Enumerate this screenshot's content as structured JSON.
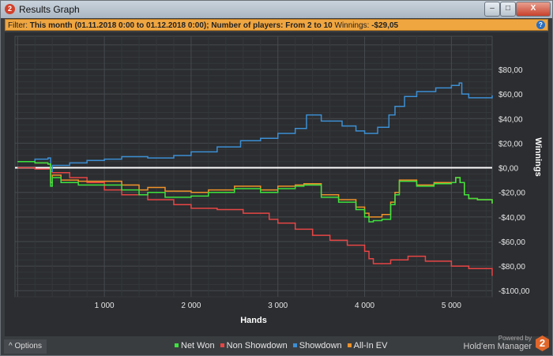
{
  "window": {
    "title": "Results Graph",
    "app_icon": "2",
    "minimize": "–",
    "maximize": "□",
    "close": "X"
  },
  "filter": {
    "label": "Filter:",
    "text": "This month (01.11.2018 0:00 to 01.12.2018 0:00); Number of players: From 2 to 10",
    "winnings_label": "Winnings:",
    "winnings_value": "-$29,05",
    "help": "?"
  },
  "footer": {
    "options": "Options",
    "options_icon": "^",
    "powered_by": "Powered by",
    "brand": "Hold'em Manager",
    "logo": "2"
  },
  "chart_data": {
    "type": "line",
    "xlabel": "Hands",
    "ylabel": "Winnings",
    "xlim": [
      -30,
      5470
    ],
    "ylim": [
      -105,
      107
    ],
    "xticks": [
      1000,
      2000,
      3000,
      4000,
      5000
    ],
    "xtick_labels": [
      "1 000",
      "2 000",
      "3 000",
      "4 000",
      "5 000"
    ],
    "yticks": [
      80,
      60,
      40,
      20,
      0,
      -20,
      -40,
      -60,
      -80,
      -100
    ],
    "ytick_labels": [
      "$80,00",
      "$60,00",
      "$40,00",
      "$20,00",
      "$0,00",
      "-$20,00",
      "-$40,00",
      "-$60,00",
      "-$80,00",
      "-$100,00"
    ],
    "grid": true,
    "legend_position": "bottom",
    "series": [
      {
        "name": "Net Won",
        "color": "#3ee23e",
        "x": [
          0,
          200,
          350,
          380,
          400,
          500,
          700,
          1000,
          1200,
          1400,
          1500,
          1700,
          2000,
          2200,
          2500,
          2800,
          3000,
          3200,
          3300,
          3500,
          3700,
          3900,
          4000,
          4050,
          4100,
          4200,
          4300,
          4350,
          4400,
          4600,
          4800,
          5000,
          5050,
          5100,
          5150,
          5200,
          5300,
          5470
        ],
        "y": [
          5,
          4,
          3,
          -15,
          -8,
          -12,
          -14,
          -14,
          -18,
          -22,
          -20,
          -24,
          -23,
          -20,
          -17,
          -20,
          -17,
          -15,
          -14,
          -24,
          -28,
          -34,
          -40,
          -44,
          -43,
          -42,
          -30,
          -22,
          -11,
          -15,
          -13,
          -12,
          -8,
          -12,
          -22,
          -25,
          -26,
          -29
        ]
      },
      {
        "name": "Non Showdown",
        "color": "#e84545",
        "x": [
          0,
          200,
          400,
          600,
          800,
          1000,
          1200,
          1500,
          1800,
          2000,
          2300,
          2600,
          2900,
          3000,
          3200,
          3400,
          3600,
          3800,
          4000,
          4050,
          4100,
          4300,
          4500,
          4700,
          5000,
          5200,
          5470
        ],
        "y": [
          0,
          -1,
          -4,
          -8,
          -12,
          -18,
          -22,
          -26,
          -30,
          -33,
          -34,
          -37,
          -42,
          -45,
          -50,
          -55,
          -59,
          -63,
          -68,
          -74,
          -78,
          -75,
          -72,
          -76,
          -80,
          -82,
          -88
        ]
      },
      {
        "name": "Showdown",
        "color": "#3c8fd4",
        "x": [
          0,
          200,
          350,
          380,
          400,
          600,
          800,
          1000,
          1200,
          1500,
          1800,
          2000,
          2300,
          2570,
          2800,
          3000,
          3200,
          3330,
          3500,
          3740,
          3900,
          4000,
          4150,
          4280,
          4350,
          4460,
          4600,
          4820,
          5000,
          5090,
          5120,
          5200,
          5470
        ],
        "y": [
          5,
          7,
          8,
          -3,
          2,
          4,
          6,
          7,
          9,
          8,
          10,
          13,
          17,
          22,
          24,
          28,
          32,
          43,
          38,
          34,
          30,
          28,
          33,
          43,
          50,
          58,
          62,
          65,
          67,
          69,
          60,
          57,
          59
        ]
      },
      {
        "name": "All-In EV",
        "color": "#f0922a",
        "x": [
          0,
          200,
          350,
          380,
          400,
          500,
          700,
          1000,
          1200,
          1400,
          1500,
          1700,
          2000,
          2200,
          2500,
          2800,
          3000,
          3200,
          3300,
          3500,
          3700,
          3900,
          4000,
          4050,
          4100,
          4200,
          4300,
          4350,
          4400,
          4600,
          4800,
          5000,
          5050,
          5100,
          5150,
          5200,
          5300,
          5470
        ],
        "y": [
          5,
          4,
          3,
          -12,
          -6,
          -10,
          -11,
          -11,
          -14,
          -18,
          -16,
          -19,
          -20,
          -18,
          -15,
          -18,
          -15,
          -14,
          -13,
          -22,
          -26,
          -32,
          -37,
          -40,
          -40,
          -38,
          -28,
          -20,
          -10,
          -14,
          -12,
          -12,
          -8,
          -12,
          -22,
          -25,
          -26,
          -29
        ]
      }
    ]
  }
}
